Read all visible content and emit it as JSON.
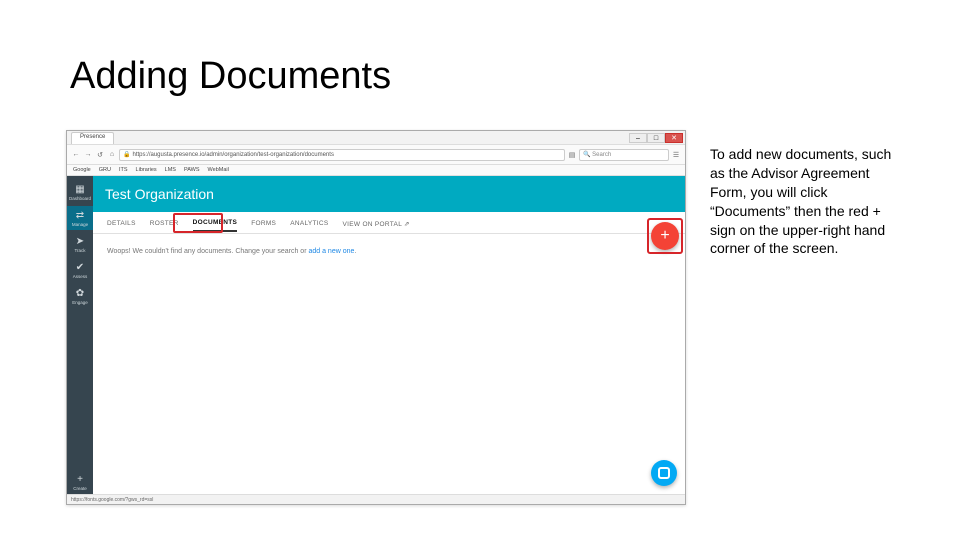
{
  "slide": {
    "title": "Adding Documents",
    "explanation": "To add new documents, such as the Advisor Agreement Form, you will click “Documents” then the red + sign on the upper-right hand corner of the screen."
  },
  "browser": {
    "tab_title": "Presence",
    "url": "https://augusta.presence.io/admin/organization/test-organization/documents",
    "search_placeholder": "Search",
    "bookmarks": [
      "Google",
      "GRU",
      "ITS",
      "Libraries",
      "LMS",
      "PAWS",
      "WebMail"
    ],
    "window_buttons": {
      "min": "–",
      "max": "□",
      "close": "✕"
    },
    "status": "https://fonts.google.com/?gws_rd=ssl"
  },
  "sidebar": {
    "items": [
      {
        "icon": "▦",
        "label": "Dashboard"
      },
      {
        "icon": "⇄",
        "label": "Manage"
      },
      {
        "icon": "➤",
        "label": "Track"
      },
      {
        "icon": "✔",
        "label": "Assess"
      },
      {
        "icon": "✿",
        "label": "Engage"
      }
    ],
    "create": {
      "icon": "+",
      "label": "Create"
    }
  },
  "org": {
    "title": "Test Organization",
    "tabs": [
      "DETAILS",
      "ROSTER",
      "DOCUMENTS",
      "FORMS",
      "ANALYTICS",
      "VIEW ON PORTAL ⇗"
    ],
    "active_tab_index": 2,
    "empty_prefix": "Woops! We couldn't find any documents. Change your search or ",
    "empty_link": "add a new one",
    "empty_suffix": "."
  },
  "fab": {
    "add": "+",
    "chat": ""
  }
}
